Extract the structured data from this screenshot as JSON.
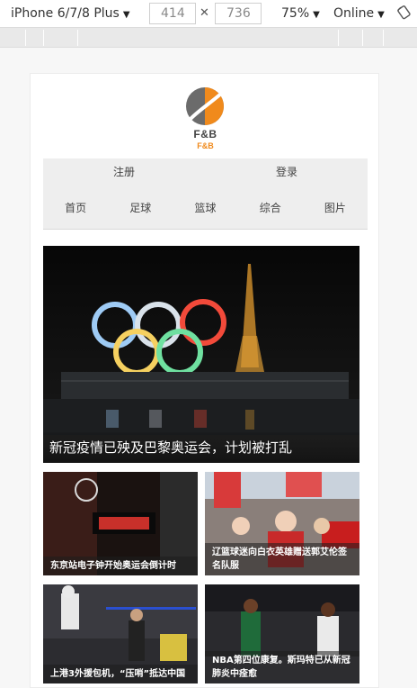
{
  "devtools": {
    "device": "iPhone 6/7/8 Plus",
    "width": "414",
    "height": "736",
    "zoom": "75%",
    "network": "Online",
    "icons": [
      "dropdown-arrow-icon",
      "rotate-icon"
    ]
  },
  "site": {
    "logo_text": "F&B",
    "logo_sub": "F&B",
    "colors": {
      "logo_gray": "#6b6b6b",
      "logo_orange": "#f08a1c"
    }
  },
  "auth": {
    "register": "注册",
    "login": "登录"
  },
  "menu": [
    "首页",
    "足球",
    "篮球",
    "综合",
    "图片"
  ],
  "hero": {
    "caption": "新冠疫情已殃及巴黎奥运会，计划被打乱"
  },
  "cards": [
    {
      "caption": "东京站电子钟开始奥运会倒计时"
    },
    {
      "caption": "辽篮球迷向白衣英雄赠送郭艾伦签名队服"
    },
    {
      "caption": "上港3外援包机，“压哨”抵达中国"
    },
    {
      "caption": "NBA第四位康复。斯玛特已从新冠肺炎中痊愈"
    }
  ]
}
